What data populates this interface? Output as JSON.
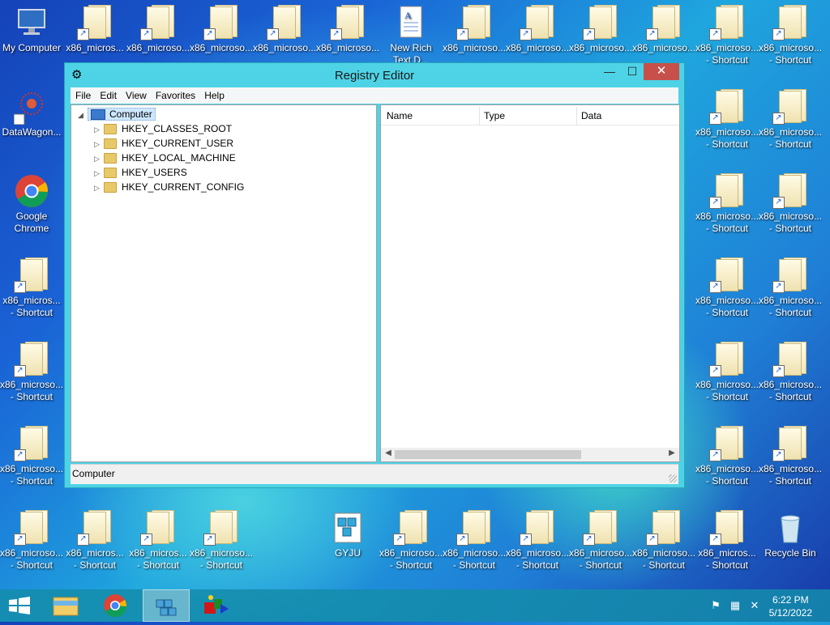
{
  "desktop": {
    "icons": [
      {
        "label": "My Computer",
        "glyph": "computer"
      },
      {
        "label": "x86_micros...",
        "glyph": "folder-doc"
      },
      {
        "label": "x86_microso...",
        "glyph": "folder-doc"
      },
      {
        "label": "x86_microso...",
        "glyph": "folder-doc"
      },
      {
        "label": "x86_microso...",
        "glyph": "folder-doc"
      },
      {
        "label": "x86_microso...",
        "glyph": "folder-doc"
      },
      {
        "label": "New Rich\nText D...",
        "glyph": "rtf-doc"
      },
      {
        "label": "x86_microso...",
        "glyph": "folder-doc"
      },
      {
        "label": "x86_microso...",
        "glyph": "folder-doc"
      },
      {
        "label": "x86_microso...",
        "glyph": "folder-doc"
      },
      {
        "label": "x86_microso...",
        "glyph": "folder-doc"
      },
      {
        "label": "x86_microso...\n- Shortcut",
        "glyph": "folder-doc"
      },
      {
        "label": "x86_microso...\n- Shortcut",
        "glyph": "folder-doc"
      },
      {
        "label": "DataWagon...",
        "glyph": "datawagon"
      },
      {
        "label": "x86_microso...\n- Shortcut",
        "glyph": "folder-doc"
      },
      {
        "label": "x86_microso...\n- Shortcut",
        "glyph": "folder-doc"
      },
      {
        "label": "Google\nChrome",
        "glyph": "chrome"
      },
      {
        "label": "x86_microso...\n- Shortcut",
        "glyph": "folder-doc"
      },
      {
        "label": "x86_microso...\n- Shortcut",
        "glyph": "folder-doc"
      },
      {
        "label": "x86_micros...\n- Shortcut",
        "glyph": "folder-doc"
      },
      {
        "label": "x86_microso...\n- Shortcut",
        "glyph": "folder-doc"
      },
      {
        "label": "x86_microso...\n- Shortcut",
        "glyph": "folder-doc"
      },
      {
        "label": "x86_microso...\n- Shortcut",
        "glyph": "folder-doc"
      },
      {
        "label": "x86_microso...\n- Shortcut",
        "glyph": "folder-doc"
      },
      {
        "label": "x86_microso...\n- Shortcut",
        "glyph": "folder-doc"
      },
      {
        "label": "x86_microso...\n- Shortcut",
        "glyph": "folder-doc"
      },
      {
        "label": "x86_microso...\n- Shortcut",
        "glyph": "folder-doc"
      },
      {
        "label": "x86_microso...\n- Shortcut",
        "glyph": "folder-doc"
      },
      {
        "label": "x86_microso...\n- Shortcut",
        "glyph": "folder-doc"
      },
      {
        "label": "x86_micros...\n- Shortcut",
        "glyph": "folder-doc"
      },
      {
        "label": "x86_micros...\n- Shortcut",
        "glyph": "folder-doc"
      },
      {
        "label": "x86_microso...\n- Shortcut",
        "glyph": "folder-doc"
      },
      {
        "label": "GYJU",
        "glyph": "registry"
      },
      {
        "label": "x86_microso...\n- Shortcut",
        "glyph": "folder-doc"
      },
      {
        "label": "x86_microso...\n- Shortcut",
        "glyph": "folder-doc"
      },
      {
        "label": "x86_microso...\n- Shortcut",
        "glyph": "folder-doc"
      },
      {
        "label": "x86_microso...\n- Shortcut",
        "glyph": "folder-doc"
      },
      {
        "label": "x86_microso...\n- Shortcut",
        "glyph": "folder-doc"
      },
      {
        "label": "x86_micros...\n- Shortcut",
        "glyph": "folder-doc"
      },
      {
        "label": "Recycle Bin",
        "glyph": "recycle"
      }
    ]
  },
  "window": {
    "title": "Registry Editor",
    "controls": {
      "minimize": "—",
      "maximize": "☐",
      "close": "✕"
    },
    "menu": [
      "File",
      "Edit",
      "View",
      "Favorites",
      "Help"
    ],
    "tree": {
      "root": "Computer",
      "hives": [
        "HKEY_CLASSES_ROOT",
        "HKEY_CURRENT_USER",
        "HKEY_LOCAL_MACHINE",
        "HKEY_USERS",
        "HKEY_CURRENT_CONFIG"
      ]
    },
    "list_columns": [
      "Name",
      "Type",
      "Data"
    ],
    "status": "Computer"
  },
  "taskbar": {
    "buttons": [
      "start",
      "file-explorer",
      "chrome",
      "registry-editor",
      "app-shapes"
    ],
    "active": "registry-editor",
    "clock_time": "6:22 PM",
    "clock_date": "5/12/2022"
  },
  "colors": {
    "window_frame": "#4ed3e6",
    "close_button": "#c7504a",
    "taskbar": "#148caa"
  }
}
